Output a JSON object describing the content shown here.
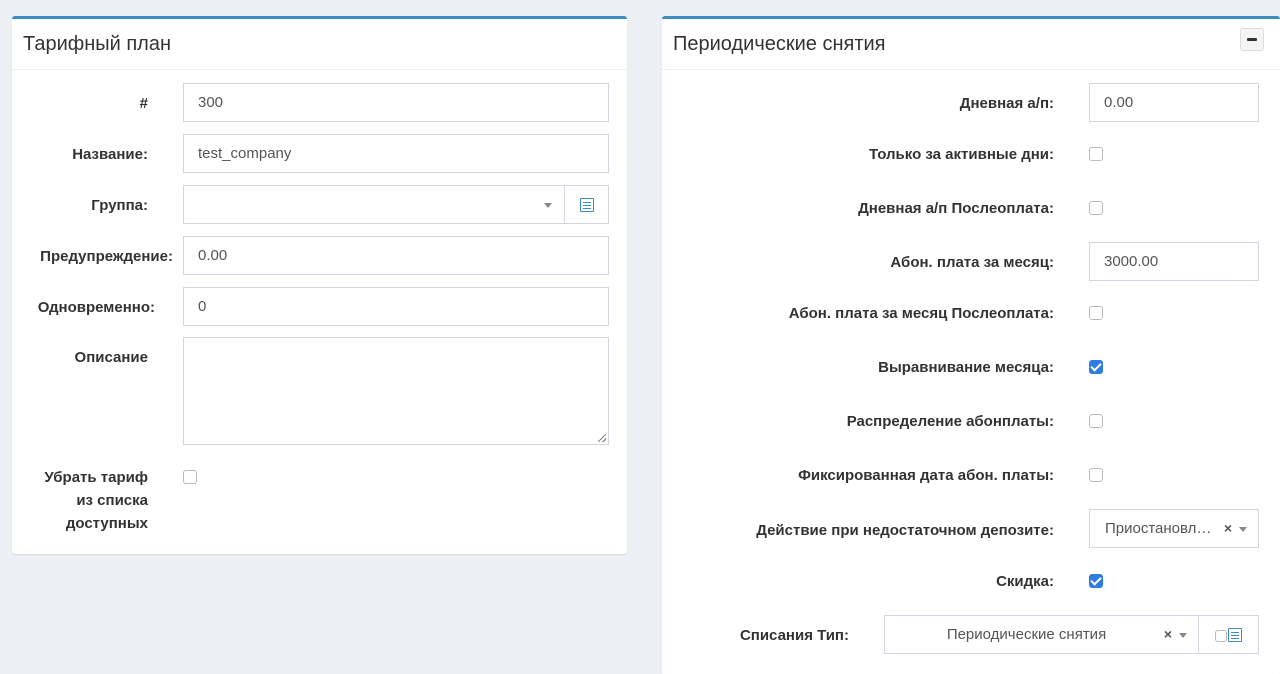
{
  "left_panel": {
    "title": "Тарифный план",
    "fields": {
      "id_label": "#",
      "id_value": "300",
      "name_label": "Название:",
      "name_value": "test_company",
      "group_label": "Группа:",
      "group_value": "",
      "warning_label": "Предупреждение:",
      "warning_value": "0.00",
      "simultaneous_label": "Одновременно:",
      "simultaneous_value": "0",
      "description_label": "Описание",
      "description_value": "",
      "hide_label_1": "Убрать тариф",
      "hide_label_2": "из списка",
      "hide_label_3": "доступных",
      "hide_checked": false
    }
  },
  "right_panel": {
    "title": "Периодические снятия",
    "fields": {
      "daily_fee_label": "Дневная а/п:",
      "daily_fee_value": "0.00",
      "active_days_label": "Только за активные дни:",
      "active_days_checked": false,
      "daily_postpaid_label": "Дневная а/п Послеоплата:",
      "daily_postpaid_checked": false,
      "monthly_fee_label": "Абон. плата за месяц:",
      "monthly_fee_value": "3000.00",
      "monthly_postpaid_label": "Абон. плата за месяц Послеоплата:",
      "monthly_postpaid_checked": false,
      "month_align_label": "Выравнивание месяца:",
      "month_align_checked": true,
      "fee_distribution_label": "Распределение абонплаты:",
      "fee_distribution_checked": false,
      "fixed_date_label": "Фиксированная дата абон. платы:",
      "fixed_date_checked": false,
      "insufficient_deposit_label": "Действие при недостаточном депозите:",
      "insufficient_deposit_value": "Приостановл…",
      "discount_label": "Скидка:",
      "discount_checked": true,
      "fees_type_label": "Списания Тип:",
      "fees_type_value": "Периодические снятия"
    }
  },
  "icons": {
    "clear": "×",
    "collapse": "minus-icon",
    "list": "list-icon"
  },
  "colors": {
    "accent": "#3c8dbc",
    "checkbox_checked": "#2f7de1",
    "background": "#ecf0f5"
  }
}
